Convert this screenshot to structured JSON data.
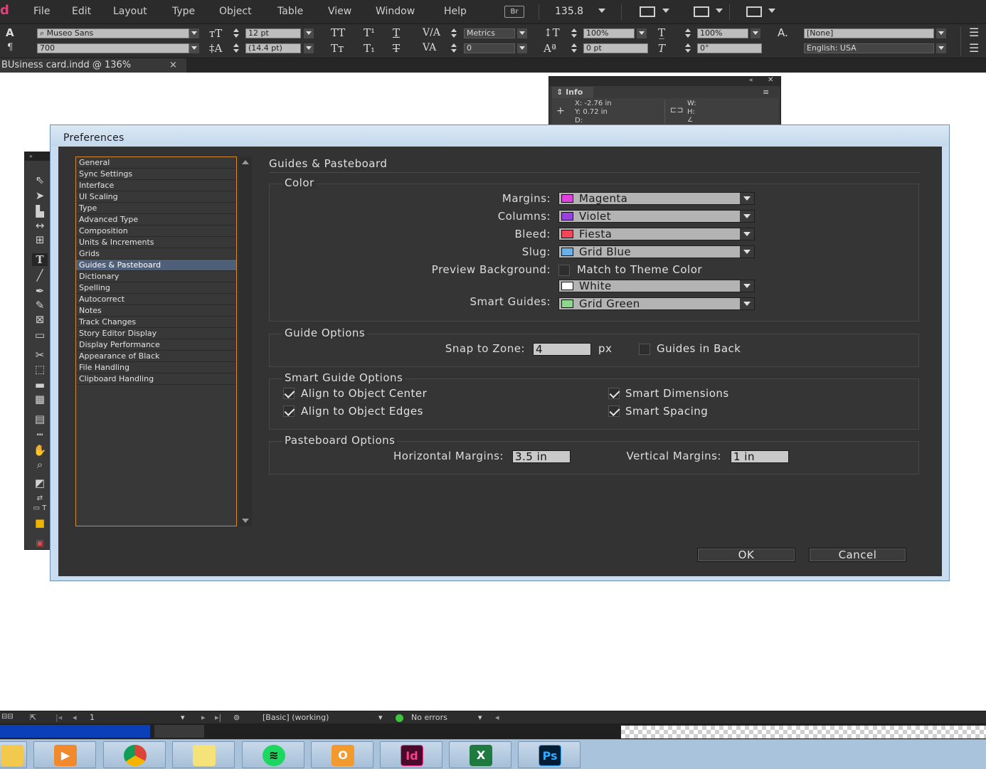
{
  "app": {
    "logo": "d",
    "menu": [
      "File",
      "Edit",
      "Layout",
      "Type",
      "Object",
      "Table",
      "View",
      "Window",
      "Help"
    ],
    "bridge_label": "Br",
    "zoom": "135.8"
  },
  "control_bar": {
    "font_family": "Museo Sans",
    "font_style": "700",
    "font_size": "12 pt",
    "leading": "(14.4 pt)",
    "kerning": "Metrics",
    "tracking": "0",
    "vertical_scale": "100%",
    "horizontal_scale": "100%",
    "baseline_shift": "0 pt",
    "skew": "0°",
    "char_style": "[None]",
    "language": "English: USA"
  },
  "document_tab": {
    "title": "BUsiness card.indd @ 136%",
    "close": "×"
  },
  "info_panel": {
    "tab": "Info",
    "x": "X: -2.76 in",
    "y": "Y: 0.72 in",
    "d": "D:",
    "w": "W:",
    "h": "H:"
  },
  "preferences": {
    "title": "Preferences",
    "categories": [
      "General",
      "Sync Settings",
      "Interface",
      "UI Scaling",
      "Type",
      "Advanced Type",
      "Composition",
      "Units & Increments",
      "Grids",
      "Guides & Pasteboard",
      "Dictionary",
      "Spelling",
      "Autocorrect",
      "Notes",
      "Track Changes",
      "Story Editor Display",
      "Display Performance",
      "Appearance of Black",
      "File Handling",
      "Clipboard Handling"
    ],
    "selected_category": "Guides & Pasteboard",
    "page_title": "Guides & Pasteboard",
    "color_section": {
      "title": "Color",
      "margins_label": "Margins:",
      "margins_value": "Magenta",
      "margins_swatch": "#e040e0",
      "columns_label": "Columns:",
      "columns_value": "Violet",
      "columns_swatch": "#9a3fe0",
      "bleed_label": "Bleed:",
      "bleed_value": "Fiesta",
      "bleed_swatch": "#f0485a",
      "slug_label": "Slug:",
      "slug_value": "Grid Blue",
      "slug_swatch": "#6ab0e8",
      "preview_bg_label": "Preview Background:",
      "match_theme_label": "Match to Theme Color",
      "preview_bg_value": "White",
      "preview_bg_swatch": "#ffffff",
      "smart_guides_label": "Smart Guides:",
      "smart_guides_value": "Grid Green",
      "smart_guides_swatch": "#8ed88e"
    },
    "guide_options": {
      "title": "Guide Options",
      "snap_label": "Snap to Zone:",
      "snap_value": "4",
      "snap_unit": "px",
      "guides_in_back_label": "Guides in Back"
    },
    "smart_guide_options": {
      "title": "Smart Guide Options",
      "align_center": "Align to Object Center",
      "align_edges": "Align to Object Edges",
      "smart_dimensions": "Smart Dimensions",
      "smart_spacing": "Smart Spacing"
    },
    "pasteboard_options": {
      "title": "Pasteboard Options",
      "horizontal_label": "Horizontal Margins:",
      "horizontal_value": "3.5 in",
      "vertical_label": "Vertical Margins:",
      "vertical_value": "1 in"
    },
    "ok": "OK",
    "cancel": "Cancel"
  },
  "status_bar": {
    "page": "1",
    "profile": "[Basic] (working)",
    "errors": "No errors"
  },
  "taskbar": {
    "indesign_label": "Id",
    "photoshop_label": "Ps"
  }
}
